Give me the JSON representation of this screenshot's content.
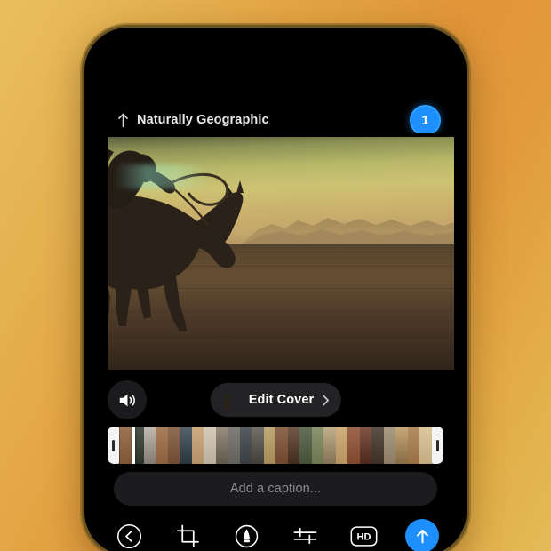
{
  "background": {
    "gradient_from": "#e9bf5e",
    "gradient_mid": "#e2953a",
    "gradient_to": "#e2bb58"
  },
  "device": {
    "frame_color": "#6e5421",
    "screen_bg": "#000000"
  },
  "header": {
    "back_arrow_icon": "arrow-up-icon",
    "title": "Naturally Geographic",
    "badge_count": "1",
    "badge_color": "#1e8fff"
  },
  "preview": {
    "media_type": "video",
    "description": "Horse and rider silhouette galloping across desert at sunset"
  },
  "cover_row": {
    "mute_icon": "speaker-wave-icon",
    "edit_cover_label": "Edit Cover",
    "chevron_icon": "chevron-right-icon",
    "thumbnail_icon": "cover-thumbnail"
  },
  "timeline": {
    "left_handle_icon": "trim-handle-left",
    "right_handle_icon": "trim-handle-right",
    "playhead_icon": "playhead-marker",
    "frames": [
      "#6b4830",
      "#8d5f3a",
      "#2f3a2e",
      "#b8b0a4",
      "#9a6a43",
      "#7d5436",
      "#3a4a55",
      "#c7a070",
      "#cfc3ae",
      "#8a7d6c",
      "#6d6a63",
      "#3e4348",
      "#5b5b52",
      "#b79a62",
      "#7c4f33",
      "#5d3e2a",
      "#4c5a3d",
      "#7a8358",
      "#b8a478",
      "#caa36a",
      "#8e4f33",
      "#6d3a28",
      "#43352a",
      "#9b8a70",
      "#c09a63",
      "#a87b4a",
      "#d8bf8e",
      "#7a5a3c"
    ]
  },
  "caption": {
    "placeholder": "Add a caption...",
    "value": ""
  },
  "toolbar": {
    "items": [
      {
        "name": "back-button",
        "icon": "chevron-left-circle-icon",
        "label": "Back"
      },
      {
        "name": "crop-button",
        "icon": "crop-icon",
        "label": "Crop"
      },
      {
        "name": "markup-button",
        "icon": "markup-pen-circle-icon",
        "label": "Markup"
      },
      {
        "name": "adjust-button",
        "icon": "sliders-icon",
        "label": "Adjust"
      },
      {
        "name": "quality-button",
        "icon": "hd-icon",
        "label": "HD"
      },
      {
        "name": "send-button",
        "icon": "arrow-up-icon",
        "label": "Send"
      }
    ],
    "hd_label": "HD",
    "send_color": "#1e8fff"
  }
}
